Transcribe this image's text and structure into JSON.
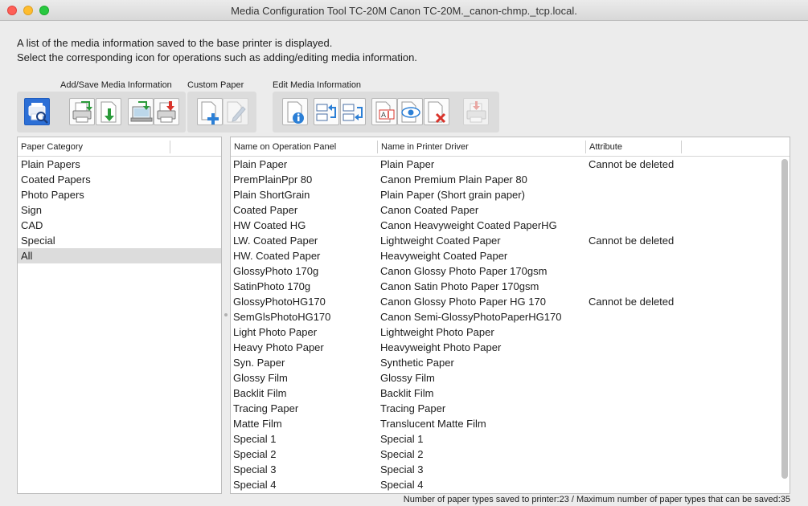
{
  "window": {
    "title": "Media Configuration Tool TC-20M Canon TC-20M._canon-chmp._tcp.local."
  },
  "description": {
    "line1": "A list of the media information saved to the base printer is displayed.",
    "line2": "Select the corresponding icon for operations such as adding/editing media information."
  },
  "toolbar": {
    "group_add_save": "Add/Save Media Information",
    "group_custom": "Custom Paper",
    "group_edit": "Edit Media Information",
    "buttons": [
      {
        "name": "printer-search-icon",
        "state": "selected"
      },
      {
        "name": "add-from-printer-icon",
        "state": "normal"
      },
      {
        "name": "download-media-icon",
        "state": "normal"
      },
      {
        "name": "save-to-computer-icon",
        "state": "normal"
      },
      {
        "name": "save-to-printer-icon",
        "state": "normal"
      },
      {
        "name": "add-custom-paper-icon",
        "state": "normal"
      },
      {
        "name": "edit-custom-paper-icon",
        "state": "disabled"
      },
      {
        "name": "media-info-icon",
        "state": "normal"
      },
      {
        "name": "move-up-icon",
        "state": "normal"
      },
      {
        "name": "move-down-icon",
        "state": "normal"
      },
      {
        "name": "rename-icon",
        "state": "normal"
      },
      {
        "name": "show-hide-icon",
        "state": "normal"
      },
      {
        "name": "delete-media-icon",
        "state": "normal"
      },
      {
        "name": "printer-update-icon",
        "state": "disabled"
      }
    ]
  },
  "categories": {
    "header": "Paper Category",
    "items": [
      "Plain Papers",
      "Coated Papers",
      "Photo Papers",
      "Sign",
      "CAD",
      "Special",
      "All"
    ],
    "selected": "All"
  },
  "media_table": {
    "headers": [
      "Name on Operation Panel",
      "Name in Printer Driver",
      "Attribute"
    ],
    "rows": [
      [
        "Plain Paper",
        "Plain Paper",
        "Cannot be deleted"
      ],
      [
        "PremPlainPpr 80",
        "Canon Premium Plain Paper 80",
        ""
      ],
      [
        "Plain ShortGrain",
        "Plain Paper (Short grain paper)",
        ""
      ],
      [
        "Coated Paper",
        "Canon Coated Paper",
        ""
      ],
      [
        "HW Coated HG",
        "Canon Heavyweight Coated PaperHG",
        ""
      ],
      [
        "LW. Coated Paper",
        "Lightweight Coated Paper",
        "Cannot be deleted"
      ],
      [
        "HW. Coated Paper",
        "Heavyweight Coated Paper",
        ""
      ],
      [
        "GlossyPhoto 170g",
        "Canon Glossy Photo Paper 170gsm",
        ""
      ],
      [
        "SatinPhoto 170g",
        "Canon Satin Photo Paper 170gsm",
        ""
      ],
      [
        "GlossyPhotoHG170",
        "Canon Glossy Photo Paper HG 170",
        "Cannot be deleted"
      ],
      [
        "SemGlsPhotoHG170",
        "Canon Semi-GlossyPhotoPaperHG170",
        ""
      ],
      [
        "Light Photo Paper",
        "Lightweight Photo Paper",
        ""
      ],
      [
        "Heavy Photo Paper",
        "Heavyweight Photo Paper",
        ""
      ],
      [
        "Syn. Paper",
        "Synthetic Paper",
        ""
      ],
      [
        "Glossy Film",
        "Glossy Film",
        ""
      ],
      [
        "Backlit Film",
        "Backlit Film",
        ""
      ],
      [
        "Tracing Paper",
        "Tracing Paper",
        ""
      ],
      [
        "Matte Film",
        "Translucent Matte Film",
        ""
      ],
      [
        "Special 1",
        "Special 1",
        ""
      ],
      [
        "Special 2",
        "Special 2",
        ""
      ],
      [
        "Special 3",
        "Special 3",
        ""
      ],
      [
        "Special 4",
        "Special 4",
        ""
      ]
    ]
  },
  "status": {
    "text": "Number of paper types saved to printer:23 / Maximum number of paper types that can be saved:35"
  },
  "colors": {
    "accent": "#2c6fd6",
    "selection": "#dcdcdc"
  }
}
